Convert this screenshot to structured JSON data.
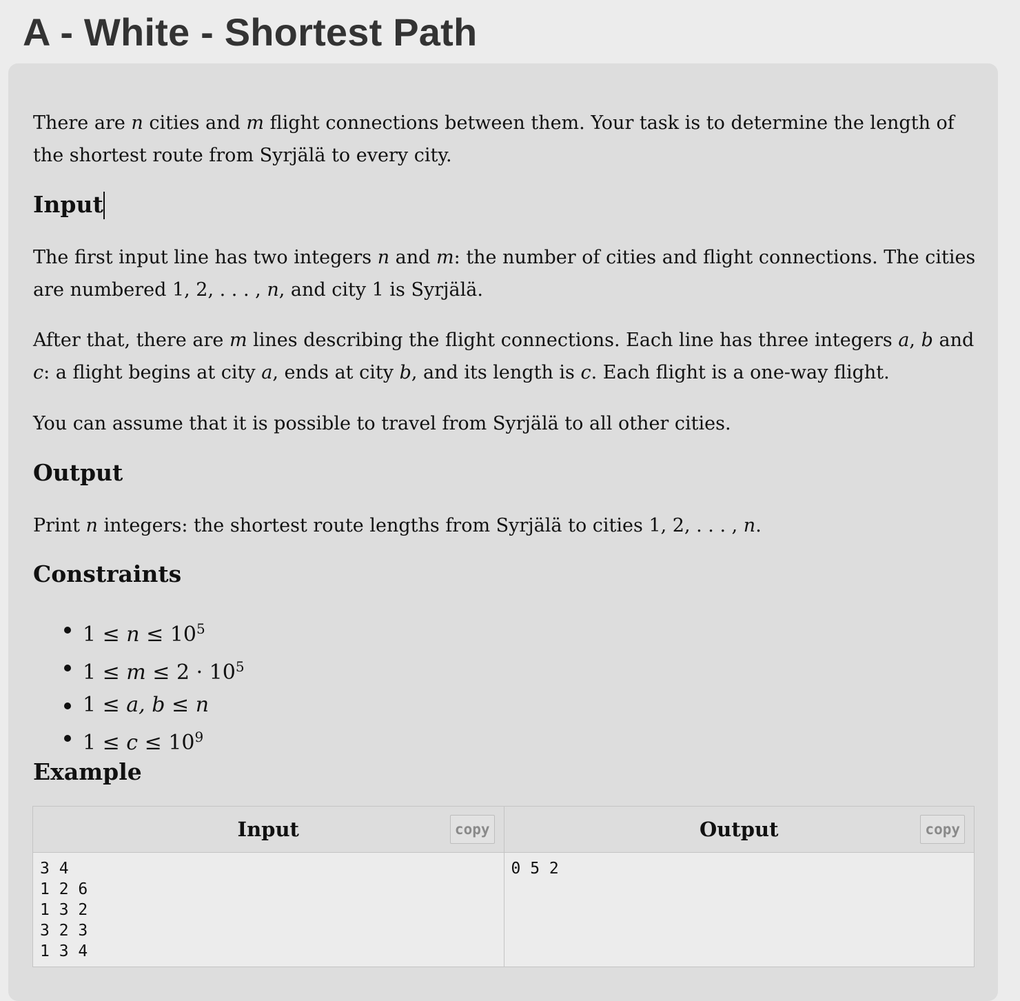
{
  "title": "A - White - Shortest Path",
  "intro": {
    "t1": "There are ",
    "n": "n",
    "t2": " cities and ",
    "m": "m",
    "t3": " flight connections between them. Your task is to determine the length of the shortest route from Syrjälä to every city."
  },
  "input_section": {
    "heading": "Input",
    "p1": {
      "t1": "The first input line has two integers ",
      "n": "n",
      "t2": " and ",
      "m": "m",
      "t3": ": the number of cities and flight connections. The cities are numbered 1, 2, . . . , ",
      "n2": "n",
      "t4": ", and city 1 is Syrjälä."
    },
    "p2": {
      "t1": "After that, there are ",
      "m": "m",
      "t2": " lines describing the flight connections. Each line has three integers ",
      "a": "a",
      "t3": ", ",
      "b": "b",
      "t4": " and ",
      "c": "c",
      "t5": ": a flight begins at city ",
      "a2": "a",
      "t6": ", ends at city ",
      "b2": "b",
      "t7": ", and its length is ",
      "c2": "c",
      "t8": ". Each flight is a one-way flight."
    },
    "p3": "You can assume that it is possible to travel from Syrjälä to all other cities."
  },
  "output_section": {
    "heading": "Output",
    "t1": "Print ",
    "n": "n",
    "t2": " integers: the shortest route lengths from Syrjälä to cities 1, 2, . . . , ",
    "n2": "n",
    "t3": "."
  },
  "constraints": {
    "heading": "Constraints",
    "c1": {
      "pre": "1 ≤ ",
      "var": "n",
      "post": " ≤ 10",
      "exp": "5"
    },
    "c2": {
      "pre": "1 ≤ ",
      "var": "m",
      "post": " ≤ 2 · 10",
      "exp": "5"
    },
    "c3": {
      "pre": "1 ≤ ",
      "var": "a, b",
      "mid": " ≤ ",
      "var2": "n"
    },
    "c4": {
      "pre": "1 ≤ ",
      "var": "c",
      "post": " ≤ 10",
      "exp": "9"
    }
  },
  "example": {
    "heading": "Example",
    "input_label": "Input",
    "output_label": "Output",
    "copy_label": "copy",
    "input_text": "3 4\n1 2 6\n1 3 2\n3 2 3\n1 3 4",
    "output_text": "0 5 2"
  }
}
